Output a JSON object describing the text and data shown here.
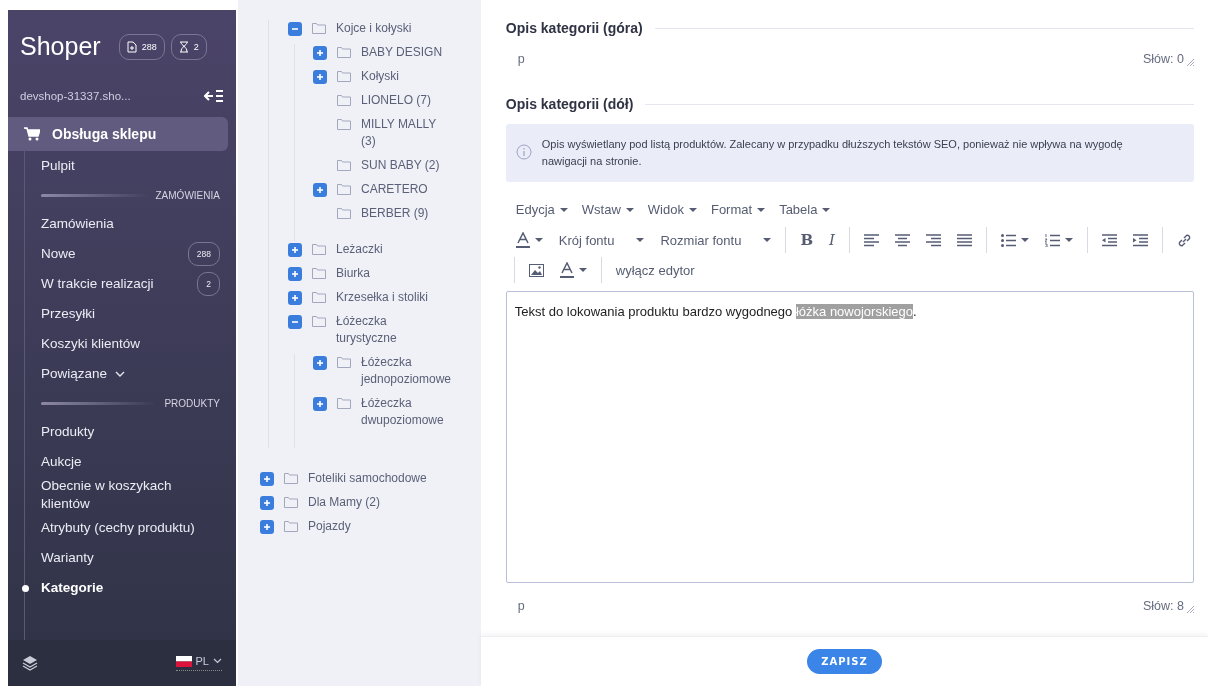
{
  "sidebar": {
    "logo": "Shoper",
    "badges": [
      {
        "kind": "document",
        "count": "288"
      },
      {
        "kind": "hourglass",
        "count": "2"
      }
    ],
    "shop": "devshop-31337.sho...",
    "section_title": "Obsługa sklepu",
    "items": [
      {
        "kind": "link",
        "label": "Pulpit",
        "selected": false
      },
      {
        "kind": "header",
        "label": "ZAMÓWIENIA"
      },
      {
        "kind": "link",
        "label": "Zamówienia",
        "selected": false
      },
      {
        "kind": "link",
        "label": "Nowe",
        "badge": "288",
        "selected": false
      },
      {
        "kind": "link",
        "label": "W trakcie realizacji",
        "badge": "2",
        "selected": false
      },
      {
        "kind": "link",
        "label": "Przesyłki",
        "selected": false
      },
      {
        "kind": "link",
        "label": "Koszyki klientów",
        "selected": false
      },
      {
        "kind": "group",
        "label": "Powiązane",
        "expanded": false,
        "selected": false
      },
      {
        "kind": "header",
        "label": "PRODUKTY"
      },
      {
        "kind": "link",
        "label": "Produkty",
        "selected": false
      },
      {
        "kind": "link",
        "label": "Aukcje",
        "selected": false
      },
      {
        "kind": "link",
        "label": "Obecnie w koszykach klientów",
        "selected": false
      },
      {
        "kind": "link",
        "label": "Atrybuty (cechy produktu)",
        "selected": false
      },
      {
        "kind": "link",
        "label": "Warianty",
        "selected": false
      },
      {
        "kind": "link",
        "label": "Kategorie",
        "selected": true
      }
    ],
    "language": "PL"
  },
  "tree": {
    "continued_children": [
      {
        "label": "Kojce i kołyski",
        "expanded": true,
        "children": [
          {
            "label": "BABY DESIGN",
            "expanded": false
          },
          {
            "label": "Kołyski",
            "expanded": false
          },
          {
            "label": "LIONELO (7)"
          },
          {
            "label": "MILLY MALLY (3)"
          },
          {
            "label": "SUN BABY (2)"
          },
          {
            "label": "CARETERO",
            "expanded": false
          },
          {
            "label": "BERBER (9)"
          }
        ]
      },
      {
        "label": "Leżaczki",
        "expanded": false
      },
      {
        "label": "Biurka",
        "expanded": false
      },
      {
        "label": "Krzesełka i stoliki",
        "expanded": false
      },
      {
        "label": "Łóżeczka turystyczne",
        "expanded": true,
        "children": [
          {
            "label": "Łóżeczka jednopoziomowe",
            "expanded": false
          },
          {
            "label": "Łóżeczka dwupoziomowe",
            "expanded": false
          }
        ]
      }
    ],
    "items": [
      {
        "label": "Foteliki samochodowe",
        "expanded": false
      },
      {
        "label": "Dla Mamy (2)",
        "expanded": false
      },
      {
        "label": "Pojazdy",
        "expanded": false
      }
    ]
  },
  "top_description": {
    "title": "Opis kategorii (góra)",
    "path": "p",
    "word_count": "Słów: 0"
  },
  "bottom_description": {
    "title": "Opis kategorii (dół)",
    "info": "Opis wyświetlany pod listą produktów. Zalecany w przypadku dłuższych tekstów SEO, ponieważ nie wpływa na wygodę nawigacji na stronie.",
    "menu": [
      "Edycja",
      "Wstaw",
      "Widok",
      "Format",
      "Tabela"
    ],
    "toolbar_rows": [
      [
        {
          "kind": "color"
        },
        {
          "kind": "select",
          "label": "Krój fontu"
        },
        {
          "kind": "select",
          "label": "Rozmiar fontu"
        },
        {
          "kind": "sep"
        },
        {
          "kind": "bold",
          "label": "B"
        },
        {
          "kind": "italic",
          "label": "I"
        },
        {
          "kind": "sep"
        },
        {
          "kind": "align-left"
        },
        {
          "kind": "align-center"
        },
        {
          "kind": "align-right"
        },
        {
          "kind": "align-justify"
        },
        {
          "kind": "sep"
        },
        {
          "kind": "bullets"
        },
        {
          "kind": "numbers"
        },
        {
          "kind": "sep"
        },
        {
          "kind": "outdent"
        },
        {
          "kind": "indent"
        },
        {
          "kind": "sep"
        },
        {
          "kind": "link"
        }
      ],
      [
        {
          "kind": "sep"
        },
        {
          "kind": "image"
        },
        {
          "kind": "color"
        },
        {
          "kind": "sep"
        },
        {
          "kind": "text",
          "label": "wyłącz edytor"
        }
      ]
    ],
    "content": [
      {
        "text": "Tekst do lokowania produktu bardzo wygodnego ",
        "selected": false
      },
      {
        "text": "łóżka nowojorskiego",
        "selected": true
      },
      {
        "text": ".",
        "selected": false
      }
    ],
    "path": "p",
    "word_count": "Słów: 8"
  },
  "save_button": "ZAPISZ"
}
